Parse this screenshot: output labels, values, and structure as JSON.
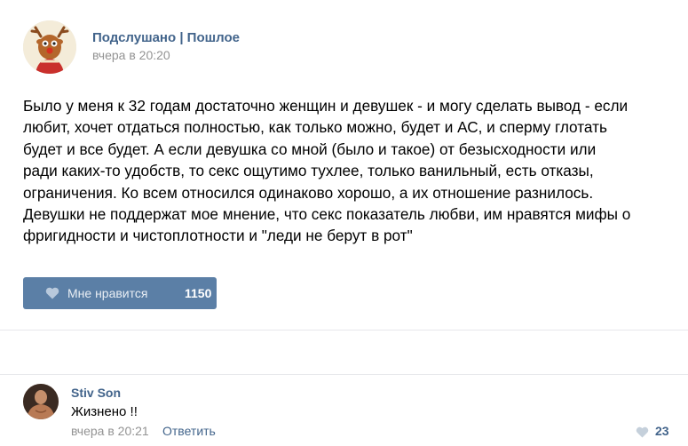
{
  "post": {
    "author_name": "Подслушано | Пошлое",
    "author_avatar_icon": "reindeer-avatar-icon",
    "time": "вчера в 20:20",
    "text_lines": [
      "Было у меня к 32 годам достаточно женщин и девушек - и могу сделать вывод - если",
      "любит, хочет отдаться полностью, как только можно, будет и АС, и сперму глотать",
      "будет и все будет. А если девушка со мной (было и такое) от безысходности или",
      "ради каких-то удобств, то секс ощутимо тухлее, только ванильный, есть отказы,",
      "ограничения. Ко всем относился одинаково хорошо, а их отношение разнилось.",
      "Девушки не поддержат мое мнение, что секс показатель любви, им нравятся мифы о",
      "фригидности и чистоплотности и \"леди не берут в рот\""
    ],
    "like_label": "Мне нравится",
    "like_count": "1150",
    "like_icon": "heart-icon"
  },
  "comment": {
    "author_name": "Stiv Son",
    "avatar_icon": "user-photo-avatar",
    "text": "Жизнено !!",
    "time": "вчера в 20:21",
    "reply_label": "Ответить",
    "like_count": "23",
    "like_icon": "heart-icon"
  },
  "colors": {
    "link": "#42648b",
    "muted": "#939393",
    "like_button_bg": "#5b7fa6",
    "divider": "#e7e8ec"
  }
}
